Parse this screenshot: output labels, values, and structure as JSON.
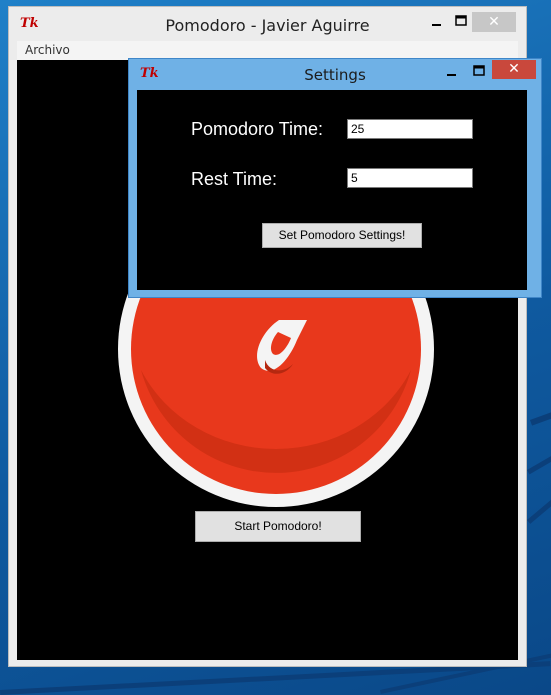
{
  "main_window": {
    "title": "Pomodoro - Javier Aguirre",
    "menu": [
      "Archivo"
    ],
    "start_button": "Start Pomodoro!"
  },
  "settings_window": {
    "title": "Settings",
    "fields": [
      {
        "label": "Pomodoro Time:",
        "value": "25"
      },
      {
        "label": "Rest Time:",
        "value": "5"
      }
    ],
    "set_button": "Set Pomodoro Settings!"
  },
  "icons": {
    "app_logo": "Tk",
    "minimize": "minimize-icon",
    "maximize": "maximize-icon",
    "close": "close-icon"
  },
  "colors": {
    "tomato_red": "#e8381c",
    "settings_border": "#6fb1e6",
    "close_red": "#c9483c",
    "desktop_blue": "#1565a8"
  }
}
